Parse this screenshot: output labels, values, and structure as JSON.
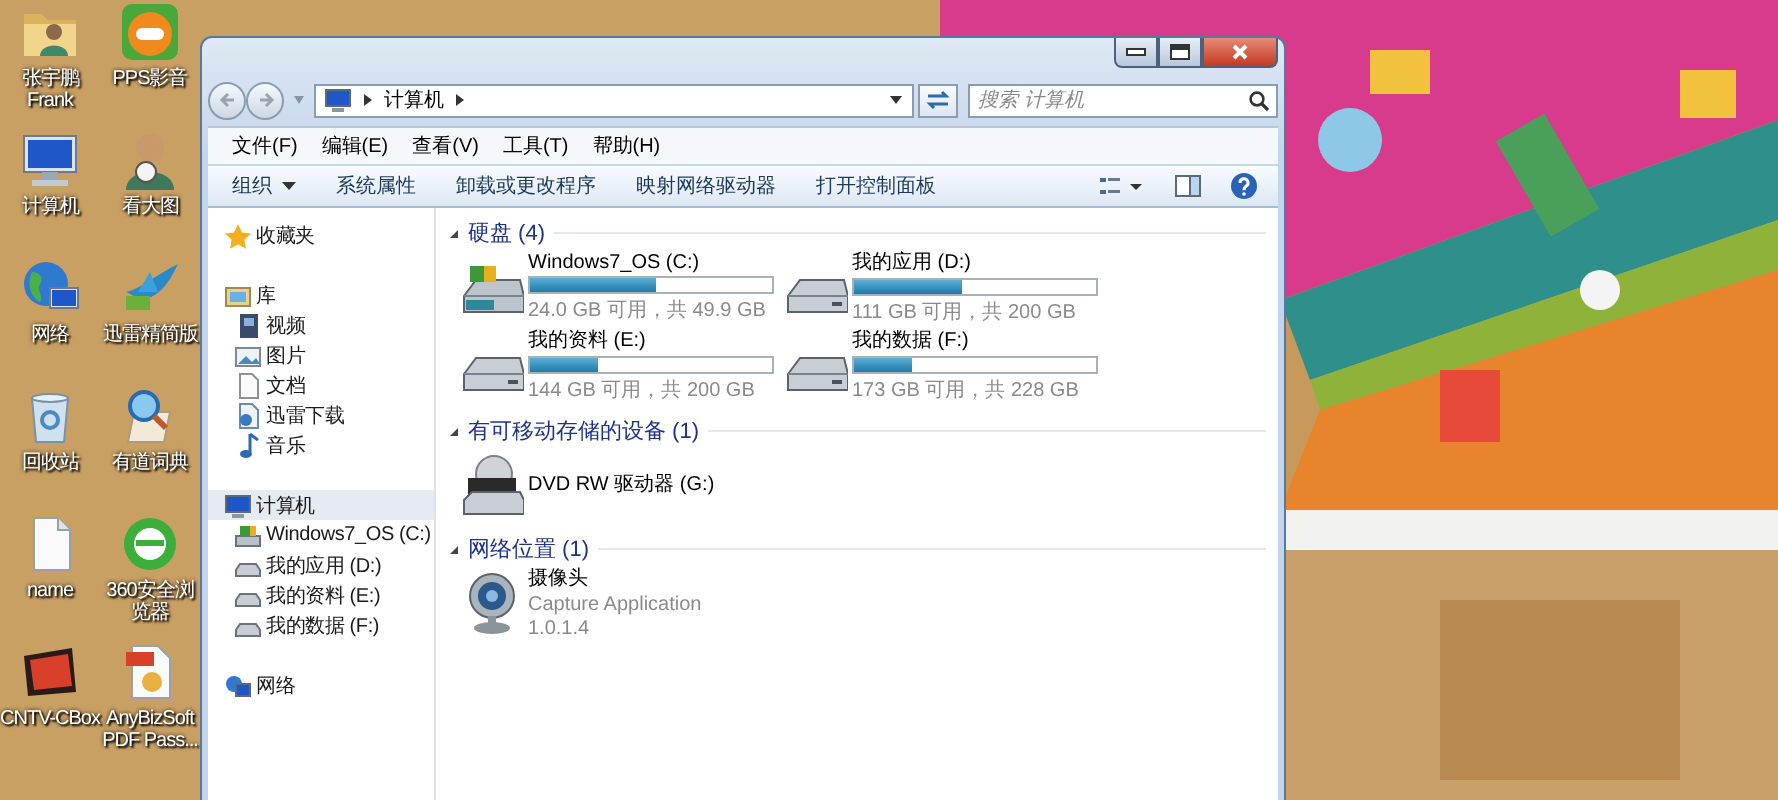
{
  "desktop": {
    "icons": [
      {
        "label": "张宇鹏 Frank",
        "kind": "user-folder"
      },
      {
        "label": "PPS影音",
        "kind": "player"
      },
      {
        "label": "计算机",
        "kind": "computer"
      },
      {
        "label": "看大图",
        "kind": "figure"
      },
      {
        "label": "网络",
        "kind": "globe"
      },
      {
        "label": "迅雷精简版",
        "kind": "bird"
      },
      {
        "label": "回收站",
        "kind": "recycle-bin"
      },
      {
        "label": "有道词典",
        "kind": "dictionary"
      },
      {
        "label": "name",
        "kind": "document"
      },
      {
        "label": "360安全浏览器",
        "kind": "browser"
      },
      {
        "label": "CNTV-CBox",
        "kind": "tv"
      },
      {
        "label": "AnyBizSoft PDF Pass...",
        "kind": "pdf"
      }
    ]
  },
  "window": {
    "address": {
      "segments": [
        "计算机"
      ]
    },
    "search": {
      "placeholder": "搜索 计算机"
    },
    "menu": [
      "文件(F)",
      "编辑(E)",
      "查看(V)",
      "工具(T)",
      "帮助(H)"
    ],
    "commands": [
      {
        "label": "组织",
        "menu": true
      },
      {
        "label": "系统属性",
        "menu": false
      },
      {
        "label": "卸载或更改程序",
        "menu": false
      },
      {
        "label": "映射网络驱动器",
        "menu": false
      },
      {
        "label": "打开控制面板",
        "menu": false
      }
    ],
    "nav": [
      {
        "label": "收藏夹",
        "kind": "star",
        "selected": false
      },
      {
        "label": "库",
        "kind": "library",
        "selected": false,
        "children": [
          {
            "label": "视频",
            "kind": "video",
            "selected": false
          },
          {
            "label": "图片",
            "kind": "picture",
            "selected": false
          },
          {
            "label": "文档",
            "kind": "document",
            "selected": false
          },
          {
            "label": "迅雷下载",
            "kind": "download",
            "selected": false
          },
          {
            "label": "音乐",
            "kind": "music",
            "selected": false
          }
        ]
      },
      {
        "label": "计算机",
        "kind": "computer",
        "selected": true,
        "children": [
          {
            "label": "Windows7_OS (C:)",
            "kind": "system-drive",
            "selected": false
          },
          {
            "label": "我的应用 (D:)",
            "kind": "drive",
            "selected": false
          },
          {
            "label": "我的资料 (E:)",
            "kind": "drive",
            "selected": false
          },
          {
            "label": "我的数据 (F:)",
            "kind": "drive",
            "selected": false
          }
        ]
      },
      {
        "label": "网络",
        "kind": "network",
        "selected": false
      }
    ],
    "groups": [
      {
        "title": "硬盘 (4)",
        "expanded": true,
        "items": [
          {
            "kind": "system-drive",
            "name": "Windows7_OS (C:)",
            "level": 0.52,
            "details": [
              "24.0 GB 可用，共 49.9 GB"
            ]
          },
          {
            "kind": "drive",
            "name": "我的应用 (D:)",
            "level": 0.445,
            "details": [
              "111 GB 可用，共 200 GB"
            ]
          },
          {
            "kind": "drive",
            "name": "我的资料 (E:)",
            "level": 0.28,
            "details": [
              "144 GB 可用，共 200 GB"
            ]
          },
          {
            "kind": "drive",
            "name": "我的数据 (F:)",
            "level": 0.24,
            "details": [
              "173 GB 可用，共 228 GB"
            ]
          }
        ]
      },
      {
        "title": "有可移动存储的设备 (1)",
        "expanded": true,
        "items": [
          {
            "kind": "dvd",
            "name": "DVD RW 驱动器 (G:)"
          }
        ]
      },
      {
        "title": "网络位置 (1)",
        "expanded": true,
        "items": [
          {
            "kind": "camera",
            "name": "摄像头",
            "details": [
              "Capture Application",
              "1.0.1.4"
            ]
          }
        ]
      }
    ]
  }
}
